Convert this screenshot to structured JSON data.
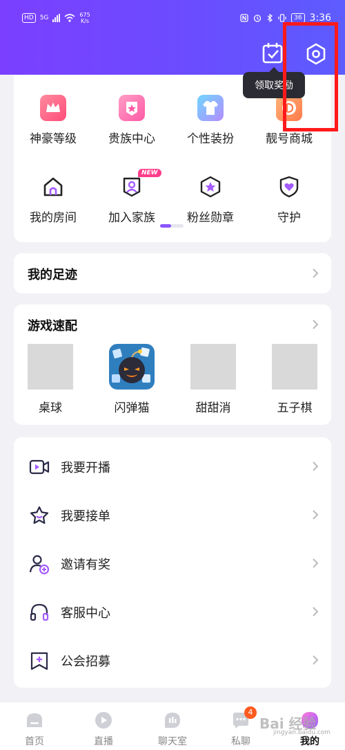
{
  "status_bar": {
    "hd_badge": "HD",
    "network": "5G",
    "speed": "675\nK/s",
    "battery": "36",
    "time": "3:36"
  },
  "header": {
    "tooltip": "领取奖励",
    "icons": [
      "calendar-check-icon",
      "settings-hexagon-icon"
    ]
  },
  "colors": {
    "header_gradient_start": "#7b3fff",
    "header_gradient_end": "#5d5cff",
    "accent": "#8a55ff",
    "highlight_box": "#ff1a1a",
    "badge_new": "#ff3d8b",
    "badge_count": "#ff5a1f"
  },
  "grid": {
    "items": [
      {
        "label": "神豪等级",
        "icon": "crown-icon"
      },
      {
        "label": "贵族中心",
        "icon": "noble-badge-icon"
      },
      {
        "label": "个性装扮",
        "icon": "tshirt-icon"
      },
      {
        "label": "靓号商城",
        "icon": "id-shop-icon"
      },
      {
        "label": "我的房间",
        "icon": "home-icon"
      },
      {
        "label": "加入家族",
        "icon": "family-icon",
        "badge": "NEW"
      },
      {
        "label": "粉丝勋章",
        "icon": "star-medal-icon"
      },
      {
        "label": "守护",
        "icon": "shield-heart-icon"
      }
    ]
  },
  "footprint": {
    "title": "我的足迹"
  },
  "games": {
    "title": "游戏速配",
    "items": [
      {
        "label": "桌球"
      },
      {
        "label": "闪弹猫"
      },
      {
        "label": "甜甜消"
      },
      {
        "label": "五子棋"
      }
    ]
  },
  "menu": {
    "items": [
      {
        "label": "我要开播",
        "icon": "live-video-icon"
      },
      {
        "label": "我要接单",
        "icon": "star-order-icon"
      },
      {
        "label": "邀请有奖",
        "icon": "invite-user-icon"
      },
      {
        "label": "客服中心",
        "icon": "headphones-icon"
      },
      {
        "label": "公会招募",
        "icon": "guild-flag-icon"
      }
    ]
  },
  "tabbar": {
    "items": [
      {
        "label": "首页",
        "icon": "home-tab-icon"
      },
      {
        "label": "直播",
        "icon": "play-tab-icon"
      },
      {
        "label": "聊天室",
        "icon": "chatroom-tab-icon"
      },
      {
        "label": "私聊",
        "icon": "message-tab-icon",
        "badge": "4"
      },
      {
        "label": "我的",
        "icon": "profile-tab-icon",
        "active": true
      }
    ]
  },
  "watermark": {
    "text": "Bai 经验",
    "sub": "jingyan.baidu.com"
  }
}
